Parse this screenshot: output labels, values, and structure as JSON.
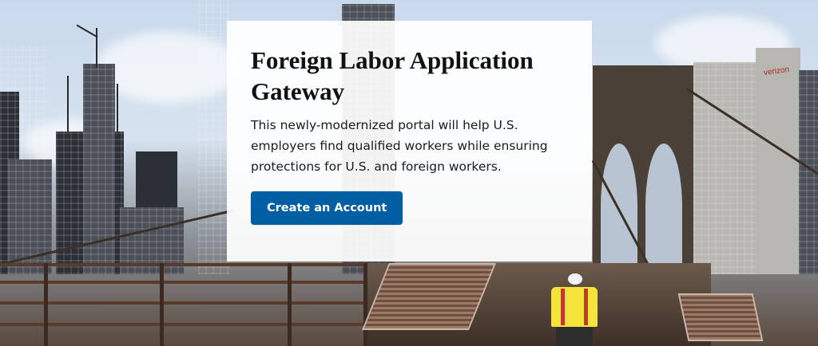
{
  "hero": {
    "title": "Foreign Labor Application Gateway",
    "description": "This newly-modernized portal will help U.S. employers find qualified workers while ensuring protections for U.S. and foreign workers.",
    "cta_label": "Create an Account"
  },
  "background": {
    "building_sign": "verizon"
  },
  "colors": {
    "cta_background": "#005ea2",
    "cta_text": "#ffffff",
    "title_text": "#111111"
  }
}
